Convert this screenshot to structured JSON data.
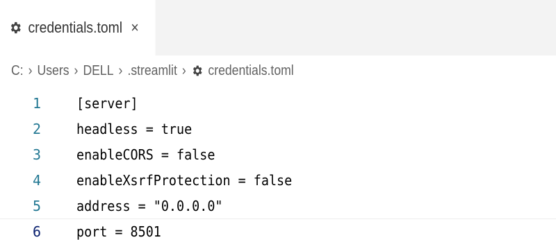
{
  "tab": {
    "icon": "gear-icon",
    "label": "credentials.toml",
    "close": "×"
  },
  "breadcrumb": {
    "items": [
      "C:",
      "Users",
      "DELL",
      ".streamlit"
    ],
    "file_icon": "gear-icon",
    "file": "credentials.toml",
    "separator": "›"
  },
  "editor": {
    "current_line": 6,
    "lines": [
      {
        "number": "1",
        "text": "[server]"
      },
      {
        "number": "2",
        "text": "headless = true"
      },
      {
        "number": "3",
        "text": "enableCORS = false"
      },
      {
        "number": "4",
        "text": "enableXsrfProtection = false"
      },
      {
        "number": "5",
        "text": "address = \"0.0.0.0\""
      },
      {
        "number": "6",
        "text": "port = 8501"
      }
    ]
  },
  "colors": {
    "line_number": "#237893",
    "active_line_number": "#0b216f",
    "tabbar_background": "#f3f3f3"
  }
}
